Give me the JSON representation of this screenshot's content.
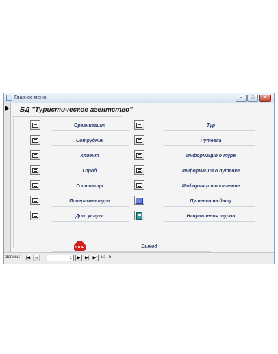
{
  "window": {
    "title": "Главное меню",
    "minimize": "‒",
    "maximize": "□",
    "close": "✕"
  },
  "form": {
    "title": "БД \"Туристическое агентство\"",
    "left_items": [
      {
        "label": "Организация",
        "icon": "form-icon"
      },
      {
        "label": "Сотрудник",
        "icon": "form-icon"
      },
      {
        "label": "Клиент",
        "icon": "form-icon"
      },
      {
        "label": "Город",
        "icon": "form-icon"
      },
      {
        "label": "Гостиница",
        "icon": "form-icon"
      },
      {
        "label": "Программа тура",
        "icon": "form-icon"
      },
      {
        "label": "Доп. услуга",
        "icon": "form-icon"
      }
    ],
    "right_items": [
      {
        "label": "Тур",
        "icon": "form-icon"
      },
      {
        "label": "Путевка",
        "icon": "form-icon"
      },
      {
        "label": "Информация о туре",
        "icon": "form-icon"
      },
      {
        "label": "Информация о путевке",
        "icon": "form-icon"
      },
      {
        "label": "Информация о клиенте",
        "icon": "form-icon"
      },
      {
        "label": "Путевки на дату",
        "icon": "report-grid-icon"
      },
      {
        "label": "Направления туров",
        "icon": "book-icon"
      }
    ],
    "exit": {
      "label": "Выход",
      "stop_text": "STOP",
      "icon": "stop-icon"
    }
  },
  "navigation": {
    "records_label": "Запись:",
    "first": "|◀",
    "prev": "◀",
    "current": "1",
    "next": "▶",
    "last": "▶|",
    "new": "▶*",
    "of_label": "из",
    "total": "5"
  }
}
